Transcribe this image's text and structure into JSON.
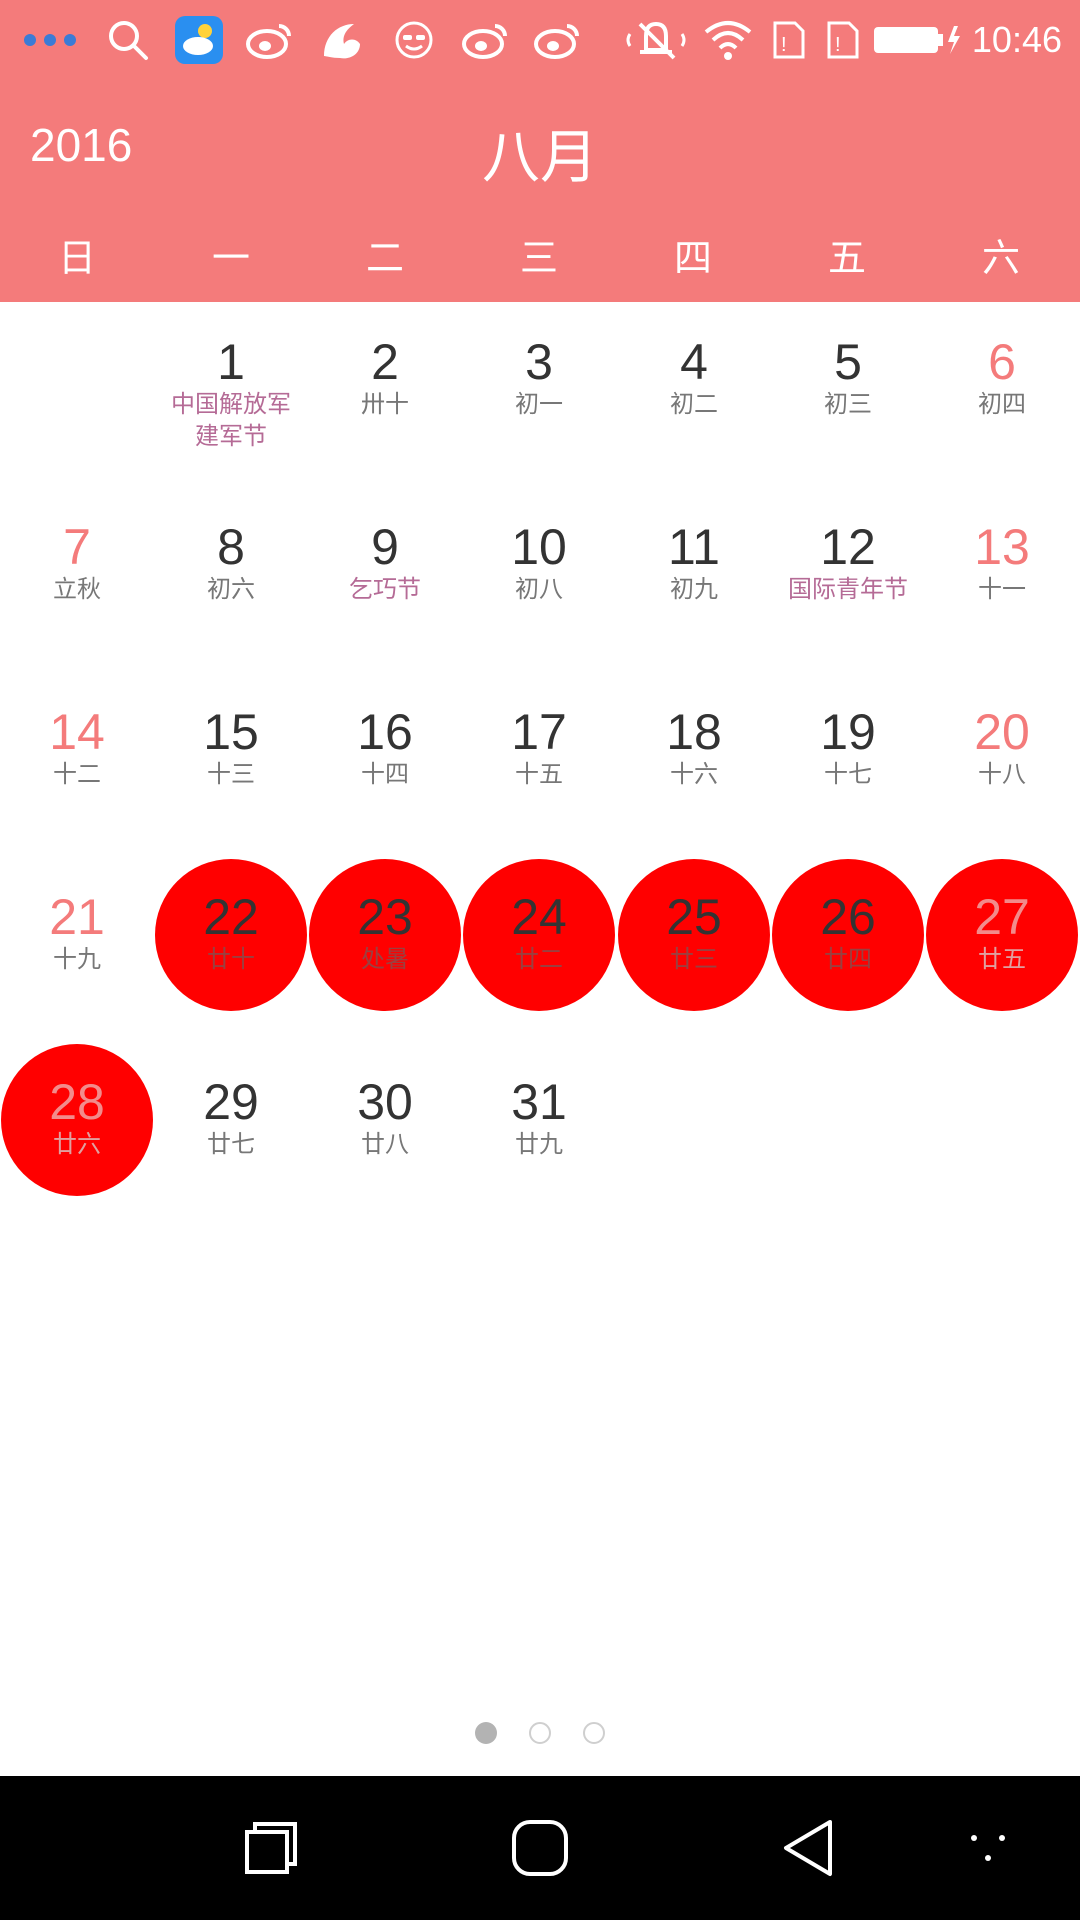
{
  "status_bar": {
    "time": "10:46",
    "icons_left": [
      "more-dots-icon",
      "search-icon",
      "weather-app-icon",
      "weibo-icon",
      "uc-browser-icon",
      "face-app-icon",
      "weibo-icon",
      "weibo-icon"
    ],
    "icons_right": [
      "mute-icon",
      "wifi-icon",
      "sim1-icon",
      "sim2-icon",
      "battery-charging-icon"
    ]
  },
  "header": {
    "year": "2016",
    "month": "八月",
    "weekdays": [
      "日",
      "一",
      "二",
      "三",
      "四",
      "五",
      "六"
    ]
  },
  "calendar": {
    "first_weekday": 1,
    "days": [
      {
        "d": "1",
        "s": "中国解放军\n建军节",
        "holiday": true
      },
      {
        "d": "2",
        "s": "卅十"
      },
      {
        "d": "3",
        "s": "初一"
      },
      {
        "d": "4",
        "s": "初二"
      },
      {
        "d": "5",
        "s": "初三"
      },
      {
        "d": "6",
        "s": "初四"
      },
      {
        "d": "7",
        "s": "立秋"
      },
      {
        "d": "8",
        "s": "初六"
      },
      {
        "d": "9",
        "s": "乞巧节",
        "holiday": true
      },
      {
        "d": "10",
        "s": "初八"
      },
      {
        "d": "11",
        "s": "初九"
      },
      {
        "d": "12",
        "s": "国际青年节",
        "holiday": true
      },
      {
        "d": "13",
        "s": "十一"
      },
      {
        "d": "14",
        "s": "十二"
      },
      {
        "d": "15",
        "s": "十三"
      },
      {
        "d": "16",
        "s": "十四"
      },
      {
        "d": "17",
        "s": "十五"
      },
      {
        "d": "18",
        "s": "十六"
      },
      {
        "d": "19",
        "s": "十七"
      },
      {
        "d": "20",
        "s": "十八"
      },
      {
        "d": "21",
        "s": "十九"
      },
      {
        "d": "22",
        "s": "廿十",
        "selected": true
      },
      {
        "d": "23",
        "s": "处暑",
        "selected": true
      },
      {
        "d": "24",
        "s": "廿二",
        "selected": true
      },
      {
        "d": "25",
        "s": "廿三",
        "selected": true
      },
      {
        "d": "26",
        "s": "廿四",
        "selected": true
      },
      {
        "d": "27",
        "s": "廿五",
        "selected": true
      },
      {
        "d": "28",
        "s": "廿六",
        "selected": true
      },
      {
        "d": "29",
        "s": "廿七"
      },
      {
        "d": "30",
        "s": "廿八"
      },
      {
        "d": "31",
        "s": "廿九"
      }
    ]
  },
  "pager": {
    "count": 3,
    "active": 0
  },
  "nav_bar": {
    "buttons": [
      "recent-apps-icon",
      "home-icon",
      "back-icon",
      "menu-icon"
    ]
  },
  "colors": {
    "accent": "#f47b7b",
    "selected": "#ff0000",
    "weekend_text": "#f47b7b",
    "holiday_text": "#b56b96"
  }
}
